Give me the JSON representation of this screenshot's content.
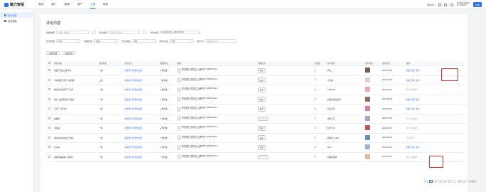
{
  "brand": {
    "name": "磁力智投"
  },
  "nav": [
    {
      "label": "首页",
      "active": false
    },
    {
      "label": "推广",
      "active": false
    },
    {
      "label": "视频",
      "active": false
    },
    {
      "label": "资产",
      "active": false
    },
    {
      "label": "工具",
      "active": true
    },
    {
      "label": "财务",
      "active": false
    }
  ],
  "top_right": {
    "item1": "帮助中心",
    "user_name": "磁力智投测试用户",
    "user_id": "ID 12345678",
    "button": "立即"
  },
  "sidebar": [
    {
      "label": "评论内容",
      "active": true
    },
    {
      "label": "回复模板",
      "active": false
    }
  ],
  "page_title": "评论内容",
  "filters": {
    "video_search_label": "视频搜索",
    "video_search_placeholder": "请输入视频ID",
    "comment_search_label": "评论搜索",
    "comment_search_placeholder": "请输入评论ID",
    "time_label": "评论时间",
    "time_range": "2023-06-08 ~ 2023-06-08",
    "type_label": "评论类型",
    "type_value": "不限",
    "status_label": "隐藏状态",
    "status_value": "不限",
    "level_label": "评论等级",
    "level_value": "不限",
    "label_label": "评论标签",
    "label_value": "不限",
    "account_label": "账户ID",
    "account_placeholder": "请输入账户ID"
  },
  "actions": {
    "batch_hide": "批量隐藏",
    "batch_reply": "批量回复"
  },
  "table": {
    "headers": [
      "",
      "评论内容",
      "评论等级",
      "外链信息",
      "隐藏状态",
      "视频",
      "视频标签",
      "",
      "点赞数",
      "用户昵称",
      "用户头像",
      "发布时间",
      "操作"
    ],
    "rows": [
      {
        "content": "我要开展线上教育班",
        "level": "一级",
        "ext": "优惠券介绍·限时发售",
        "status": "未隐藏",
        "vtitle": "带货视频, 带货卖货, 直播带货 12345678 item",
        "vsub": "ID: 1234567890123456789",
        "tag": "服务",
        "cnt": "2",
        "nick": "鸡太",
        "avatar": "#7a5a4a",
        "time": "2023-06-08",
        "ops": [
          {
            "t": "隐藏",
            "c": "link"
          },
          {
            "t": "回复",
            "c": "link"
          },
          {
            "t": "置顶",
            "c": "link"
          }
        ]
      },
      {
        "content": "平常随便记录下, 看到哪...",
        "level": "二级",
        "ext": "优惠券介绍·限时发售",
        "status": "未隐藏",
        "vtitle": "带货视频, 带货卖货, 直播带货 12345678 item",
        "vsub": "ID: 1234567890123456789",
        "tag": "服务",
        "cnt": "3",
        "nick": "元到底",
        "avatar": "#e8cfc7",
        "time": "2023-06-08",
        "ops": [
          {
            "t": "隐藏",
            "c": "link"
          },
          {
            "t": "回复",
            "c": "link"
          },
          {
            "t": "置顶",
            "c": "link"
          }
        ]
      },
      {
        "content": "我的这家真能下了这家",
        "level": "一级",
        "ext": "优惠券介绍·限时发售",
        "status": "未隐藏",
        "vtitle": "带货视频, 带货卖货, 直播带货 12345678 item",
        "vsub": "ID: 1234567890123456789",
        "tag": "服务",
        "cnt": "3",
        "nick": "YHKJHB",
        "avatar": "#f4a6b8",
        "time": "2023-06-08",
        "ops": [
          {
            "t": "暂无可用操作",
            "c": "muted"
          }
        ]
      },
      {
        "content": "我好, 这是我相忙下去看...",
        "level": "一级",
        "ext": "优惠券介绍·限时发售",
        "status": "未隐藏",
        "vtitle": "带货视频, 带货卖货, 直播带货 12345678 item",
        "vsub": "ID: 1234567890123456789",
        "tag": "服务",
        "cnt": "3",
        "nick": "智能直播拉卖呢",
        "avatar": "#8e6d5c",
        "time": "2023-06-08",
        "ops": [
          {
            "t": "隐藏",
            "c": "link"
          },
          {
            "t": "回复",
            "c": "link"
          },
          {
            "t": "置顶",
            "c": "link"
          }
        ]
      },
      {
        "content": "正月了, 正月呼",
        "level": "一级",
        "ext": "优惠券介绍·限时发售",
        "status": "未隐藏",
        "vtitle": "带货视频, 带货卖货, 直播带货 12345678 item",
        "vsub": "ID: 1234567890123456789",
        "tag": "服务",
        "cnt": "3",
        "nick": "花朵宝贝",
        "avatar": "#d67ba9",
        "time": "2023-06-08",
        "ops": [
          {
            "t": "隐藏",
            "c": "link"
          },
          {
            "t": "回复",
            "c": "link"
          },
          {
            "t": "置顶",
            "c": "link"
          }
        ]
      },
      {
        "content": "拍摄的",
        "level": "一级",
        "ext": "优惠券介绍·限时发售",
        "status": "未隐藏",
        "vtitle": "带货视频, 带货卖货, 直播带货 12345678 item",
        "vsub": "ID: 1234567890123456789",
        "tag": "— — —",
        "cnt": "3",
        "nick": "漂时不已",
        "avatar": "#b0a0c8",
        "time": "2023-06-08",
        "ops": [
          {
            "t": "暂无可用操作",
            "c": "muted"
          }
        ]
      },
      {
        "content": "领奖品",
        "level": "一级",
        "ext": "优惠券介绍·限时发售",
        "status": "未隐藏",
        "vtitle": "带货视频, 带货卖货, 直播带货 12345678 item",
        "vsub": "ID: 1234567890123456789",
        "tag": "服务",
        "cnt": "3",
        "nick": "红衣少女",
        "avatar": "#c45555",
        "time": "2023-06-08",
        "ops": [
          {
            "t": "暂无可用操作",
            "c": "muted"
          }
        ]
      },
      {
        "content": "我好在中的这是下去看...",
        "level": "一级",
        "ext": "优惠券介绍·限时发售",
        "status": "未隐藏",
        "vtitle": "带货视频, 带货卖货, 直播带货 12345678 item",
        "vsub": "ID: 1234567890123456789",
        "tag": "服务",
        "cnt": "3",
        "nick": "衣服花儿HED",
        "avatar": "#6c8fb0",
        "time": "2023-06-08",
        "ops": [
          {
            "t": "不可回复",
            "c": "muted"
          }
        ]
      },
      {
        "content": "怎么说",
        "level": "一级",
        "ext": "优惠券介绍·限时发售",
        "status": "未隐藏",
        "vtitle": "带货视频, 带货卖货, 直播带货 12345678 item",
        "vsub": "ID: 1234567890123456789",
        "tag": "服务",
        "cnt": "3",
        "nick": "Mary",
        "avatar": "#9ab3d6",
        "time": "2023-06-08",
        "ops": [
          {
            "t": "隐藏",
            "c": "link"
          },
          {
            "t": "回复",
            "c": "link"
          },
          {
            "t": "置顶",
            "c": "link"
          }
        ]
      },
      {
        "content": "每题直播看看, 好看吗...",
        "level": "一级",
        "ext": "优惠券介绍·限时发售",
        "status": "未隐藏",
        "vtitle": "带货视频, 带货卖货, 直播带货 12345678 item",
        "vsub": "ID: 1234567890123456789",
        "tag": "— — —",
        "cnt": "3",
        "nick": "直播新装啊",
        "avatar": "#e2b89a",
        "time": "2023-06-08",
        "ops": [
          {
            "t": "暂无可用操作",
            "c": "muted"
          }
        ]
      }
    ]
  },
  "pager": {
    "prev": "<",
    "pages": [
      "1",
      "2",
      "3",
      "4",
      "5",
      "...",
      "11"
    ],
    "next": ">",
    "size": "10 条/页"
  }
}
